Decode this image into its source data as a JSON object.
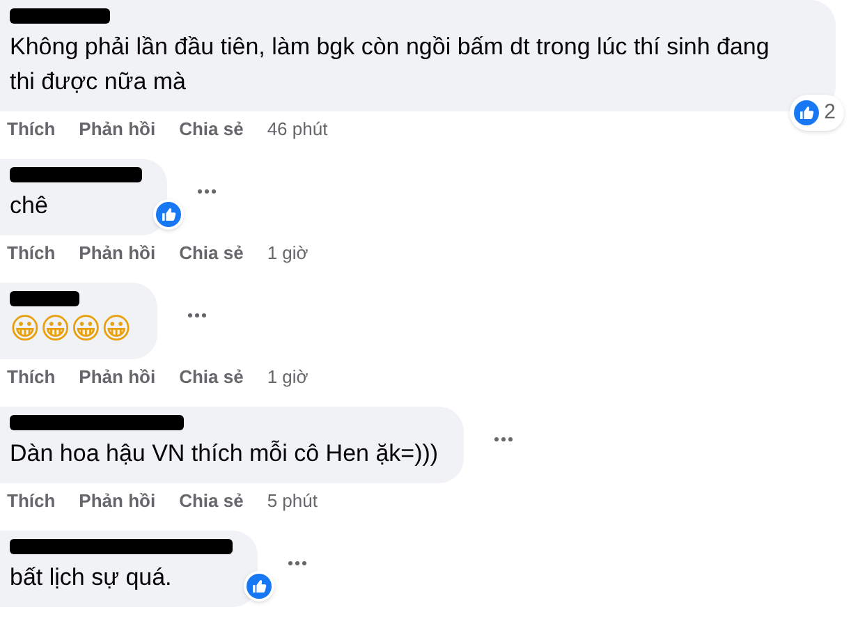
{
  "comments": [
    {
      "text": "Không phải lần đầu tiên, làm bgk còn ngồi bấm dt trong lúc thí sinh đang thi được nữa mà",
      "reaction": {
        "kind": "corner",
        "count": "2"
      },
      "more": false,
      "actions": [
        "Thích",
        "Phản hồi",
        "Chia sẻ"
      ],
      "time": "46 phút"
    },
    {
      "text": "chê",
      "reaction": {
        "kind": "inline"
      },
      "more": true,
      "actions": [
        "Thích",
        "Phản hồi",
        "Chia sẻ"
      ],
      "time": "1 giờ"
    },
    {
      "text": "😀😀😀😀",
      "kind": "emoji",
      "more": true,
      "actions": [
        "Thích",
        "Phản hồi",
        "Chia sẻ"
      ],
      "time": "1 giờ"
    },
    {
      "text": "Dàn hoa hậu VN thích mỗi cô Hen ặk=)))",
      "more": true,
      "actions": [
        "Thích",
        "Phản hồi",
        "Chia sẻ"
      ],
      "time": "5 phút"
    },
    {
      "text": "bất lịch sự quá.",
      "reaction": {
        "kind": "inline"
      },
      "more": true
    }
  ]
}
